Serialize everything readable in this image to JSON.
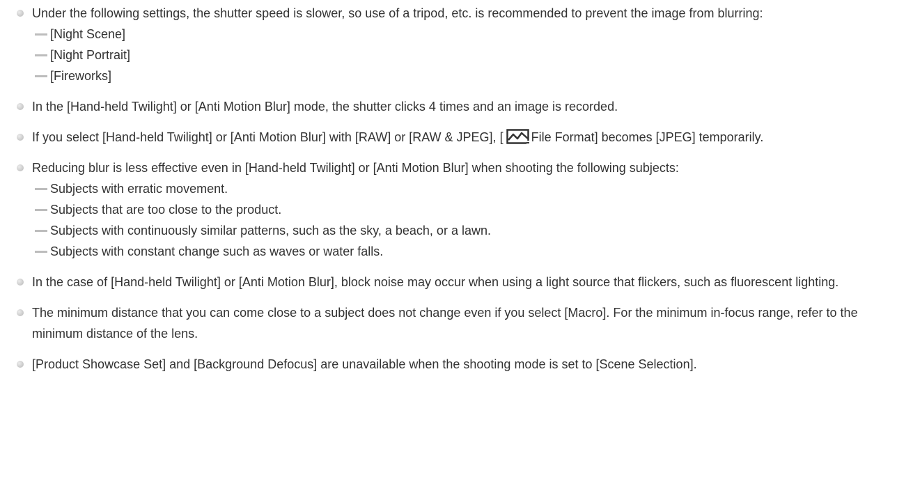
{
  "notes": [
    {
      "text": "Under the following settings, the shutter speed is slower, so use of a tripod, etc. is recommended to prevent the image from blurring:",
      "sub_items": [
        "[Night Scene]",
        "[Night Portrait]",
        "[Fireworks]"
      ]
    },
    {
      "text": "In the [Hand-held Twilight] or [Anti Motion Blur] mode, the shutter clicks 4 times and an image is recorded."
    },
    {
      "text_before_icon": "If you select [Hand-held Twilight] or [Anti Motion Blur] with [RAW] or [RAW & JPEG], [",
      "icon": "still-image-icon",
      "text_after_icon": "File Format] becomes [JPEG] temporarily."
    },
    {
      "text": "Reducing blur is less effective even in [Hand-held Twilight] or [Anti Motion Blur] when shooting the following subjects:",
      "sub_items": [
        "Subjects with erratic movement.",
        "Subjects that are too close to the product.",
        "Subjects with continuously similar patterns, such as the sky, a beach, or a lawn.",
        "Subjects with constant change such as waves or water falls."
      ]
    },
    {
      "text": "In the case of [Hand-held Twilight] or [Anti Motion Blur], block noise may occur when using a light source that flickers, such as fluorescent lighting."
    },
    {
      "text": "The minimum distance that you can come close to a subject does not change even if you select [Macro]. For the minimum in-focus range, refer to the minimum distance of the lens."
    },
    {
      "text": "[Product Showcase Set] and [Background Defocus] are unavailable when the shooting mode is set to [Scene Selection]."
    }
  ],
  "colors": {
    "text": "#333333",
    "bullet": "#c7c7c7",
    "dash": "#bdbdbd"
  }
}
